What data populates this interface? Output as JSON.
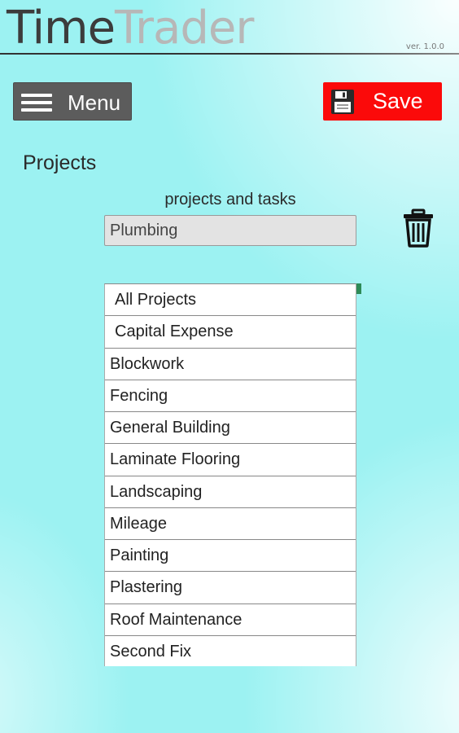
{
  "app": {
    "logo_word1": "Time",
    "logo_word2": "Trader",
    "version": "ver. 1.0.0"
  },
  "toolbar": {
    "menu_label": "Menu",
    "save_label": "Save"
  },
  "page": {
    "section_title": "Projects",
    "field_label": "projects and tasks",
    "project_value": "Plumbing"
  },
  "project_list": {
    "items": [
      " All Projects",
      " Capital Expense",
      "Blockwork",
      "Fencing",
      "General Building",
      "Laminate Flooring",
      "Landscaping",
      "Mileage",
      "Painting",
      "Plastering",
      "Roof Maintenance",
      "Second Fix"
    ]
  },
  "icons": {
    "menu": "hamburger-icon",
    "save": "floppy-disk-icon",
    "delete": "trash-icon"
  },
  "colors": {
    "background": "#9cf2f2",
    "menu_button": "#5c5c5c",
    "save_button": "#fb0a0a",
    "scroll_thumb": "#2e8b57"
  }
}
